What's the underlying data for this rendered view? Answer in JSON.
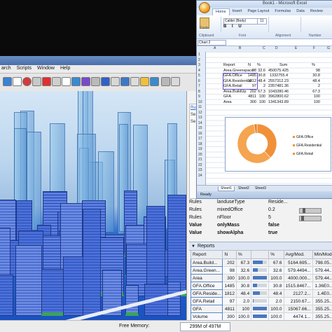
{
  "menu": [
    "arch",
    "Scripts",
    "Window",
    "Help"
  ],
  "viewport_side": {
    "link": "Ru",
    "label1": "Se",
    "label2": "Se"
  },
  "rules": [
    {
      "label": "Rules",
      "name": "landuseType",
      "value": "Reside..."
    },
    {
      "label": "Rules",
      "name": "mixedOffice",
      "value": "0.2"
    },
    {
      "label": "Rules",
      "name": "nFloor",
      "value": "5"
    },
    {
      "label": "Value",
      "name": "onlyMass",
      "value": "false"
    },
    {
      "label": "Value",
      "name": "showAlpha",
      "value": "true"
    }
  ],
  "reports": {
    "title": "Reports",
    "headers": [
      "Report",
      "N",
      "%",
      "%",
      "Avg/Mod.",
      "Min/Mod."
    ],
    "rows": [
      [
        "Area.Build...",
        "202",
        "67.3",
        "67.6",
        "5164.695...",
        "798.05..."
      ],
      [
        "Area.Green...",
        "98",
        "32.6",
        "32.6",
        "579.4494...",
        "579.44..."
      ],
      [
        "Area",
        "300",
        "100.0",
        "100.0",
        "4000.000...",
        "579.44..."
      ],
      [
        "GFA.Office",
        "1485",
        "30.8",
        "30.8",
        "1515.8467...",
        "1.36E0..."
      ],
      [
        "GFA.Reside...",
        "1812",
        "48.4",
        "48.4",
        "2127.2...",
        "1.4E0..."
      ],
      [
        "GFA.Retail",
        "97",
        "2.0",
        "2.0",
        "2150.67...",
        "355.25..."
      ],
      [
        "GFA",
        "4811",
        "100",
        "100.0",
        "15067.66...",
        "355.25..."
      ],
      [
        "Volume",
        "300",
        "100.0",
        "100.0",
        "4474.1...",
        "355.25..."
      ]
    ],
    "bars": [
      0.676,
      0.326,
      1.0,
      0.308,
      0.484,
      0.02,
      1.0,
      1.0
    ]
  },
  "status": {
    "free_memory_label": "Free Memory:",
    "free_memory_value": "299M of 497M"
  },
  "excel": {
    "title": "Book1 - Microsoft Excel",
    "tabs": [
      "Home",
      "Insert",
      "Page Layout",
      "Formulas",
      "Data",
      "Review"
    ],
    "font": "Calibri (Body)",
    "font_size": "11",
    "paste": "Paste",
    "bold_italic": "B I U",
    "groups": [
      "Clipboard",
      "Font",
      "Alignment",
      "Number"
    ],
    "name_box": "Chart 2",
    "columns": [
      "A",
      "B",
      "C",
      "D",
      "E",
      "F",
      "G"
    ],
    "row_numbers": [
      "1",
      "2",
      "3",
      "4",
      "5",
      "6",
      "7",
      "8",
      "9",
      "10",
      "11",
      "12",
      "13",
      "14",
      "15",
      "16",
      "17",
      "18",
      "19",
      "20",
      "21",
      "22",
      "23",
      "24"
    ],
    "table_header": [
      "Report",
      "N",
      "%",
      "Sum",
      "%"
    ],
    "table_rows": [
      [
        "Area.Greenspace",
        "98",
        "32.6",
        "450075.425",
        "98"
      ],
      [
        "GFA.Office",
        "1485",
        "30.8",
        "1332755.4",
        "30.8"
      ],
      [
        "GFA.Residential",
        "1812",
        "48.4",
        "2557312.23",
        "48.4"
      ],
      [
        "GFA.Retail",
        "97",
        "2",
        "2357481.36",
        "2"
      ],
      [
        "Area.BuildUp",
        "202",
        "67.3",
        "1043280.46",
        "67.3"
      ],
      [
        "GFA",
        "4811",
        "100",
        "3962800.62",
        "100"
      ],
      [
        "Area",
        "300",
        "100",
        "1341343.89",
        "100"
      ]
    ],
    "legend": [
      "GFA.Office",
      "GFA.Residential",
      "GFA.Retail"
    ],
    "sheets": [
      "Sheet1",
      "Sheet2",
      "Sheet3"
    ],
    "status": "Ready"
  },
  "chart_data": {
    "type": "pie",
    "donut": true,
    "categories": [
      "GFA.Office",
      "GFA.Residential",
      "GFA.Retail"
    ],
    "values": [
      30.8,
      48.4,
      2.0
    ],
    "colors": [
      "#f0913a",
      "#f5a450",
      "#e8802a"
    ]
  }
}
